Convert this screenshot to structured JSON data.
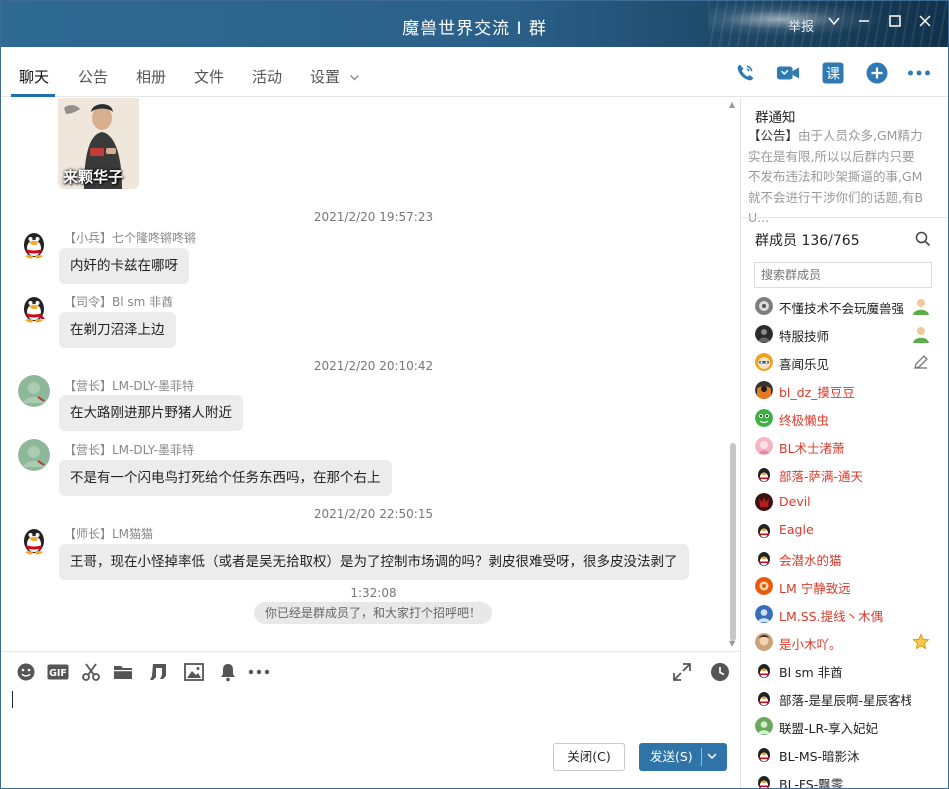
{
  "window": {
    "title": "魔兽世界交流 I 群",
    "report_label": "举报"
  },
  "tabs": [
    {
      "label": "聊天"
    },
    {
      "label": "公告"
    },
    {
      "label": "相册"
    },
    {
      "label": "文件"
    },
    {
      "label": "活动"
    },
    {
      "label": "设置"
    }
  ],
  "toolbar_icons": [
    "phone-icon",
    "video-call-icon",
    "course-icon",
    "add-app-icon",
    "more-icon"
  ],
  "toolbar_course_label": "课",
  "chat": {
    "photo_caption": "来颗华子",
    "messages": [
      {
        "timestamp": "2021/2/20 19:57:23",
        "sender": "【小兵】七个隆咚锵咚锵",
        "text": "内奸的卡兹在哪呀",
        "avatar": "penguin"
      },
      {
        "timestamp": "",
        "sender": "【司令】Bl sm 非酋",
        "text": "在剃刀沼泽上边",
        "avatar": "penguin-red"
      },
      {
        "timestamp": "2021/2/20 20:10:42",
        "sender": "【营长】LM-DLY-墨菲特",
        "text": "在大路刚进那片野猪人附近",
        "avatar": "green"
      },
      {
        "timestamp": "",
        "sender": "【营长】LM-DLY-墨菲特",
        "text": "不是有一个闪电鸟打死给个任务东西吗，在那个右上",
        "avatar": "green"
      },
      {
        "timestamp": "2021/2/20 22:50:15",
        "sender": "【师长】LM猫猫",
        "text": "王哥，现在小怪掉率低（或者是吴无拾取权）是为了控制市场调的吗？剥皮很难受呀，很多皮没法剥了",
        "avatar": "penguin"
      }
    ],
    "last_time": "1:32:08",
    "system_note": "你已经是群成员了，和大家打个招呼吧！"
  },
  "input_toolbar_icons": [
    "emoji-icon",
    "gif-icon",
    "scissors-icon",
    "folder-icon",
    "music-icon",
    "image-icon",
    "bell-icon",
    "more-icon",
    "expand-icon",
    "history-clock-icon"
  ],
  "input_toolbar_gif_label": "GIF",
  "buttons": {
    "close": "关闭(C)",
    "send": "发送(S)"
  },
  "side": {
    "notice_title": "群通知",
    "notice_tag": "【公告】",
    "notice_text": "由于人员众多,GM精力实在是有限,所以以后群内只要不发布违法和吵架撕逼的事,GM就不会进行干涉你们的话题,有BU...",
    "members_title": "群成员 136/765",
    "search_placeholder": "搜索群成员",
    "members": [
      {
        "name": "不懂技术不会玩魔兽强",
        "color": "#222222",
        "avatar": "gray-round",
        "badge": "owner"
      },
      {
        "name": "特服技师",
        "color": "#222222",
        "avatar": "dark",
        "badge": "owner"
      },
      {
        "name": "喜闻乐见",
        "color": "#222222",
        "avatar": "cartoon",
        "badge": "edit"
      },
      {
        "name": "bl_dz_摸豆豆",
        "color": "#d93a2b",
        "avatar": "orange-dark",
        "badge": ""
      },
      {
        "name": "终极懒虫",
        "color": "#d93a2b",
        "avatar": "green-bug",
        "badge": ""
      },
      {
        "name": "BL术士渚萧",
        "color": "#d93a2b",
        "avatar": "pink",
        "badge": ""
      },
      {
        "name": "部落-萨满-通天",
        "color": "#d93a2b",
        "avatar": "penguin",
        "badge": ""
      },
      {
        "name": "Devil",
        "color": "#d93a2b",
        "avatar": "dark-red",
        "badge": ""
      },
      {
        "name": "Eagle",
        "color": "#d93a2b",
        "avatar": "penguin",
        "badge": ""
      },
      {
        "name": "会潜水的猫",
        "color": "#d93a2b",
        "avatar": "penguin",
        "badge": ""
      },
      {
        "name": "LM 宁静致远",
        "color": "#d93a2b",
        "avatar": "orange",
        "badge": ""
      },
      {
        "name": "LM.SS.提线丶木偶",
        "color": "#d93a2b",
        "avatar": "blue",
        "badge": ""
      },
      {
        "name": "是小木吖。",
        "color": "#d93a2b",
        "avatar": "face",
        "badge": "star"
      },
      {
        "name": "Bl sm 非酋",
        "color": "#222222",
        "avatar": "penguin",
        "badge": ""
      },
      {
        "name": "部落-是星辰啊-星辰客栈",
        "color": "#222222",
        "avatar": "penguin",
        "badge": ""
      },
      {
        "name": "联盟-LR-享入妃妃",
        "color": "#222222",
        "avatar": "green",
        "badge": ""
      },
      {
        "name": "BL-MS-暗影沐",
        "color": "#222222",
        "avatar": "penguin",
        "badge": ""
      },
      {
        "name": "BL-FS-飘零",
        "color": "#222222",
        "avatar": "penguin",
        "badge": ""
      }
    ]
  }
}
